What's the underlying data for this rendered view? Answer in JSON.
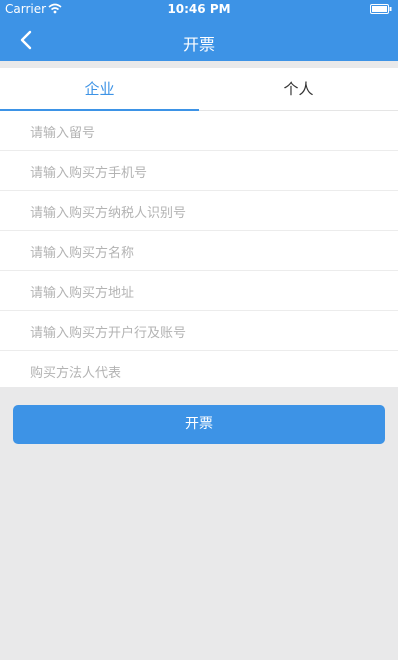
{
  "status_bar": {
    "carrier": "Carrier",
    "time": "10:46 PM"
  },
  "nav": {
    "title": "开票"
  },
  "tabs": [
    {
      "label": "企业",
      "active": true
    },
    {
      "label": "个人",
      "active": false
    }
  ],
  "form": {
    "fields": [
      {
        "placeholder": "请输入留号"
      },
      {
        "placeholder": "请输入购买方手机号"
      },
      {
        "placeholder": "请输入购买方纳税人识别号"
      },
      {
        "placeholder": "请输入购买方名称"
      },
      {
        "placeholder": "请输入购买方地址"
      },
      {
        "placeholder": "请输入购买方开户行及账号"
      },
      {
        "placeholder": "购买方法人代表"
      }
    ]
  },
  "submit": {
    "label": "开票"
  },
  "colors": {
    "accent": "#3d93e6",
    "background": "#e9e9ea",
    "placeholder": "#b3b3b3"
  }
}
